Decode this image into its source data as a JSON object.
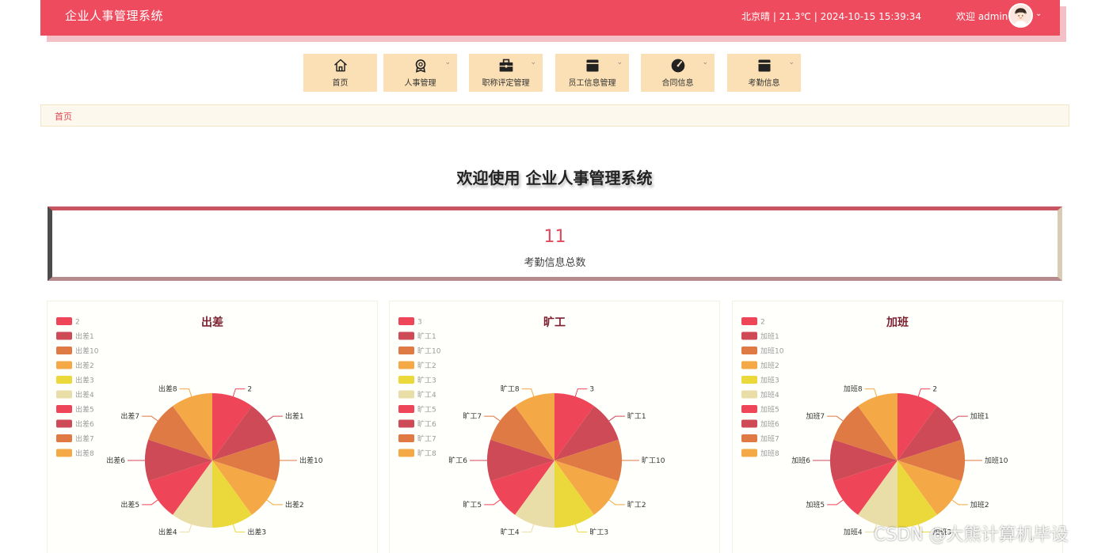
{
  "header": {
    "app_title": "企业人事管理系统",
    "weather": "北京晴 | 21.3℃",
    "datetime": "2024-10-15  15:39:34",
    "welcome_text": "欢迎 admin",
    "caret": "⌄"
  },
  "nav": {
    "items": [
      {
        "label": "首页",
        "icon": "home-icon",
        "dropdown": false
      },
      {
        "label": "人事管理",
        "icon": "award-icon",
        "dropdown": true
      },
      {
        "label": "职称评定管理",
        "icon": "briefcase-icon",
        "dropdown": true
      },
      {
        "label": "员工信息管理",
        "icon": "card-icon",
        "dropdown": true
      },
      {
        "label": "合同信息",
        "icon": "gauge-icon",
        "dropdown": true
      },
      {
        "label": "考勤信息",
        "icon": "card-icon",
        "dropdown": true
      }
    ]
  },
  "breadcrumb": {
    "home": "首页"
  },
  "welcome_title": "欢迎使用 企业人事管理系统",
  "stat": {
    "value": "11",
    "label": "考勤信息总数"
  },
  "colors": {
    "brand": "#ef4b5e",
    "palette": [
      "#ee4658",
      "#cf4a57",
      "#e07a45",
      "#f4a846",
      "#ebd83a",
      "#e9dda8",
      "#ee4658",
      "#cf4a57",
      "#e07a45",
      "#f4a846"
    ]
  },
  "chart_data": [
    {
      "type": "pie",
      "title": "出差",
      "legend_position": "top-left",
      "labels": [
        "2",
        "出差1",
        "出差10",
        "出差2",
        "出差3",
        "出差4",
        "出差5",
        "出差6",
        "出差7",
        "出差8"
      ],
      "values": [
        1,
        1,
        1,
        1,
        1,
        1,
        1,
        1,
        1,
        1
      ],
      "legend": [
        "2",
        "出差1",
        "出差10",
        "出差2",
        "出差3",
        "出差4",
        "出差5",
        "出差6",
        "出差7",
        "出差8"
      ]
    },
    {
      "type": "pie",
      "title": "旷工",
      "legend_position": "top-left",
      "labels": [
        "3",
        "旷工1",
        "旷工10",
        "旷工2",
        "旷工3",
        "旷工4",
        "旷工5",
        "旷工6",
        "旷工7",
        "旷工8"
      ],
      "values": [
        1,
        1,
        1,
        1,
        1,
        1,
        1,
        1,
        1,
        1
      ],
      "legend": [
        "3",
        "旷工1",
        "旷工10",
        "旷工2",
        "旷工3",
        "旷工4",
        "旷工5",
        "旷工6",
        "旷工7",
        "旷工8"
      ]
    },
    {
      "type": "pie",
      "title": "加班",
      "legend_position": "top-left",
      "labels": [
        "2",
        "加班1",
        "加班10",
        "加班2",
        "加班3",
        "加班4",
        "加班5",
        "加班6",
        "加班7",
        "加班8"
      ],
      "values": [
        1,
        1,
        1,
        1,
        1,
        1,
        1,
        1,
        1,
        1
      ],
      "legend": [
        "2",
        "加班1",
        "加班10",
        "加班2",
        "加班3",
        "加班4",
        "加班5",
        "加班6",
        "加班7",
        "加班8"
      ]
    }
  ],
  "watermark": "CSDN @大熊计算机毕设"
}
